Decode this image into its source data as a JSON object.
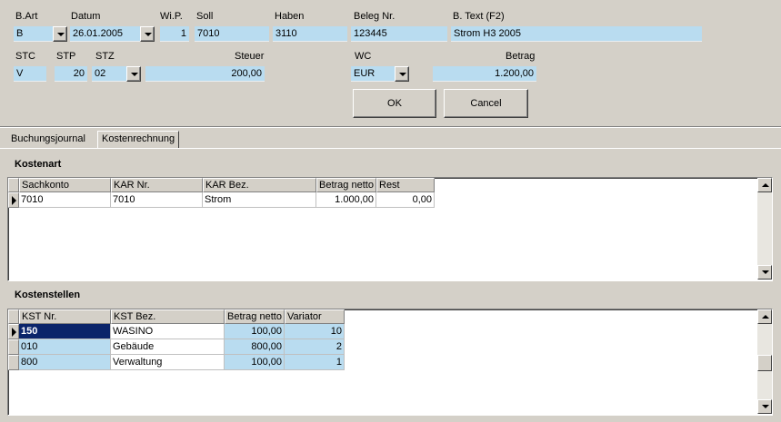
{
  "header": {
    "labels": {
      "bart": "B.Art",
      "datum": "Datum",
      "wip": "Wi.P.",
      "soll": "Soll",
      "haben": "Haben",
      "belegnr": "Beleg Nr.",
      "btext": "B. Text (F2)",
      "stc": "STC",
      "stp": "STP",
      "stz": "STZ",
      "steuer": "Steuer",
      "wc": "WC",
      "betrag": "Betrag"
    },
    "values": {
      "bart": "B",
      "datum": "26.01.2005",
      "wip": "1",
      "soll": "7010",
      "haben": "3110",
      "belegnr": "123445",
      "btext": "Strom H3 2005",
      "stc": "V",
      "stp": "20",
      "stz": "02",
      "steuer": "200,00",
      "wc": "EUR",
      "betrag": "1.200,00"
    }
  },
  "buttons": {
    "ok": "OK",
    "cancel": "Cancel"
  },
  "tabs": {
    "buchungsjournal": "Buchungsjournal",
    "kostenrechnung": "Kostenrechnung"
  },
  "kostenart": {
    "title": "Kostenart",
    "columns": [
      "Sachkonto",
      "KAR Nr.",
      "KAR Bez.",
      "Betrag netto",
      "Rest"
    ],
    "rows": [
      [
        "7010",
        "7010",
        "Strom",
        "1.000,00",
        "0,00"
      ]
    ]
  },
  "kostenstellen": {
    "title": "Kostenstellen",
    "columns": [
      "KST Nr.",
      "KST Bez.",
      "Betrag netto",
      "Variator"
    ],
    "rows": [
      [
        "150",
        "WASINO",
        "100,00",
        "10"
      ],
      [
        "010",
        "Gebäude",
        "800,00",
        "2"
      ],
      [
        "800",
        "Verwaltung",
        "100,00",
        "1"
      ]
    ]
  },
  "colors": {
    "field": "#b9dcf0",
    "window": "#d4d0c8",
    "selection": "#0a246a"
  }
}
